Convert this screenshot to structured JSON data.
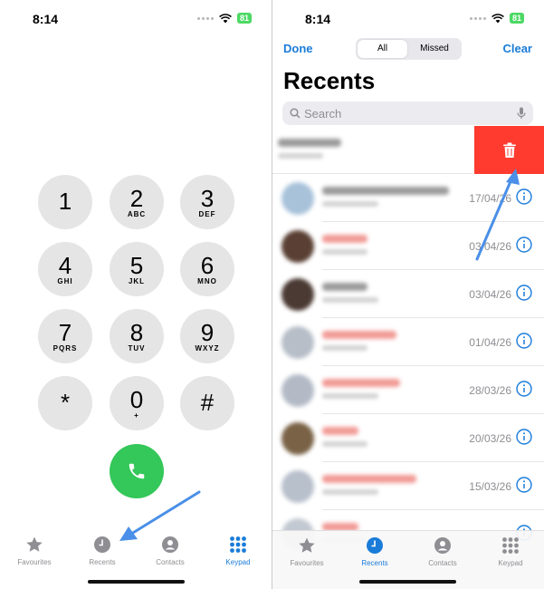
{
  "left": {
    "status": {
      "time": "8:14",
      "battery": "81"
    },
    "keys": [
      {
        "digit": "1",
        "letters": ""
      },
      {
        "digit": "2",
        "letters": "ABC"
      },
      {
        "digit": "3",
        "letters": "DEF"
      },
      {
        "digit": "4",
        "letters": "GHI"
      },
      {
        "digit": "5",
        "letters": "JKL"
      },
      {
        "digit": "6",
        "letters": "MNO"
      },
      {
        "digit": "7",
        "letters": "PQRS"
      },
      {
        "digit": "8",
        "letters": "TUV"
      },
      {
        "digit": "9",
        "letters": "WXYZ"
      },
      {
        "digit": "*",
        "letters": ""
      },
      {
        "digit": "0",
        "letters": "+"
      },
      {
        "digit": "#",
        "letters": ""
      }
    ],
    "tabs": [
      {
        "label": "Favourites",
        "icon": "star-icon"
      },
      {
        "label": "Recents",
        "icon": "clock-icon"
      },
      {
        "label": "Contacts",
        "icon": "person-icon"
      },
      {
        "label": "Keypad",
        "icon": "keypad-icon",
        "active": true
      }
    ]
  },
  "right": {
    "status": {
      "time": "8:14",
      "battery": "81"
    },
    "done_label": "Done",
    "clear_label": "Clear",
    "segment": {
      "all": "All",
      "missed": "Missed"
    },
    "title": "Recents",
    "search_placeholder": "Search",
    "calls": [
      {
        "date": "",
        "missed": false,
        "swiped": true
      },
      {
        "date": "17/04/26",
        "missed": false
      },
      {
        "date": "03/04/26",
        "missed": true
      },
      {
        "date": "03/04/26",
        "missed": false
      },
      {
        "date": "01/04/26",
        "missed": true
      },
      {
        "date": "28/03/26",
        "missed": true
      },
      {
        "date": "20/03/26",
        "missed": true
      },
      {
        "date": "15/03/26",
        "missed": true
      },
      {
        "date": "",
        "missed": true
      }
    ],
    "tabs": [
      {
        "label": "Favourites",
        "icon": "star-icon"
      },
      {
        "label": "Recents",
        "icon": "clock-icon",
        "active": true
      },
      {
        "label": "Contacts",
        "icon": "person-icon"
      },
      {
        "label": "Keypad",
        "icon": "keypad-icon"
      }
    ]
  },
  "colors": {
    "accent": "#1a7cd8",
    "call_green": "#34c759",
    "delete_red": "#ff3b30",
    "annotation_arrow": "#4a8fe8"
  }
}
